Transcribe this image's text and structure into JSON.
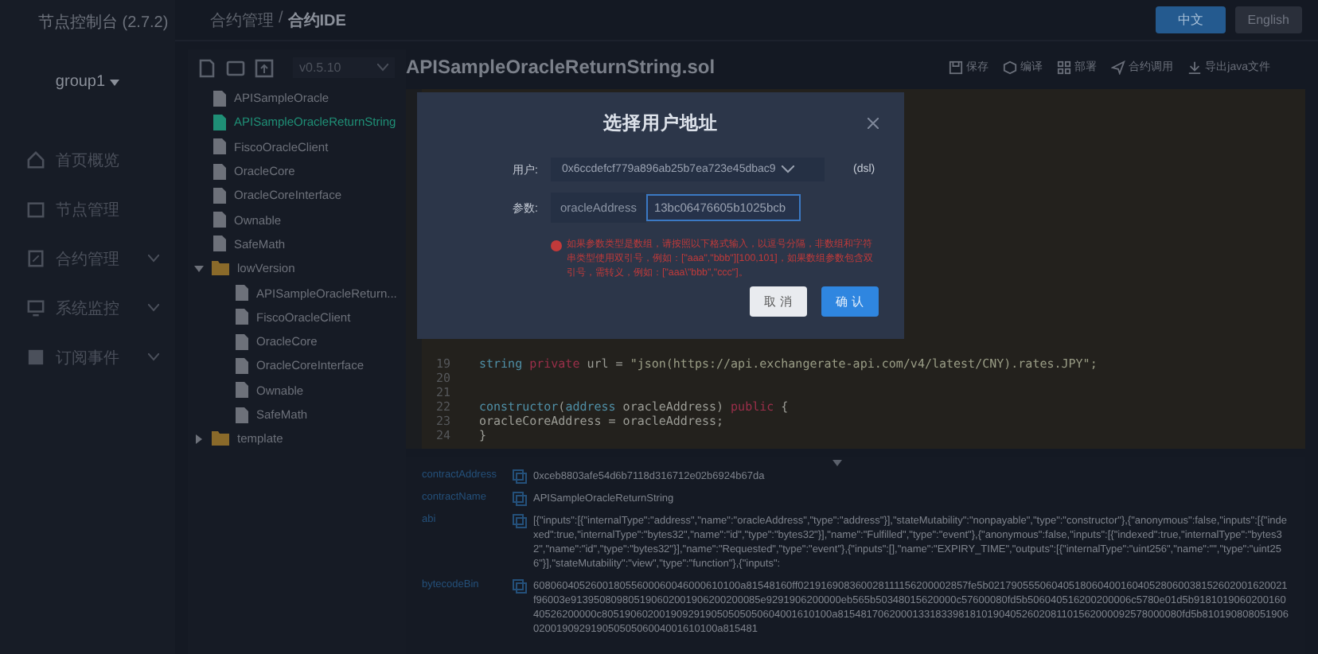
{
  "sidebar": {
    "title": "节点控制台 (2.7.2)",
    "group": "group1",
    "menu": [
      {
        "label": "首页概览",
        "expandable": false
      },
      {
        "label": "节点管理",
        "expandable": false
      },
      {
        "label": "合约管理",
        "expandable": true
      },
      {
        "label": "系统监控",
        "expandable": true
      },
      {
        "label": "订阅事件",
        "expandable": true
      }
    ]
  },
  "topbar": {
    "breadcrumb": [
      "合约管理",
      "合约IDE"
    ],
    "breadcrumb_separator": "/",
    "languages": [
      {
        "label": "中文",
        "selected": true
      },
      {
        "label": "English",
        "selected": false
      }
    ]
  },
  "file_panel": {
    "version": "v0.5.10",
    "tree": [
      {
        "kind": "file",
        "name": "APISampleOracle",
        "selected": false
      },
      {
        "kind": "file",
        "name": "APISampleOracleReturnString",
        "selected": true
      },
      {
        "kind": "file",
        "name": "FiscoOracleClient",
        "selected": false
      },
      {
        "kind": "file",
        "name": "OracleCore",
        "selected": false
      },
      {
        "kind": "file",
        "name": "OracleCoreInterface",
        "selected": false
      },
      {
        "kind": "file",
        "name": "Ownable",
        "selected": false
      },
      {
        "kind": "file",
        "name": "SafeMath",
        "selected": false
      },
      {
        "kind": "folder",
        "name": "lowVersion",
        "expanded": true,
        "children": [
          {
            "kind": "file",
            "name": "APISampleOracleReturn...",
            "selected": false
          },
          {
            "kind": "file",
            "name": "FiscoOracleClient",
            "selected": false
          },
          {
            "kind": "file",
            "name": "OracleCore",
            "selected": false
          },
          {
            "kind": "file",
            "name": "OracleCoreInterface",
            "selected": false
          },
          {
            "kind": "file",
            "name": "Ownable",
            "selected": false
          },
          {
            "kind": "file",
            "name": "SafeMath",
            "selected": false
          }
        ]
      },
      {
        "kind": "folder",
        "name": "template",
        "expanded": false
      }
    ]
  },
  "editor": {
    "filename": "APISampleOracleReturnString.sol",
    "actions": [
      {
        "label": "保存"
      },
      {
        "label": "编译"
      },
      {
        "label": "部署"
      },
      {
        "label": "合约调用"
      },
      {
        "label": "导出java文件"
      }
    ],
    "lines": [
      {
        "number": "19",
        "tokens": [
          {
            "kind": "type",
            "text": "string "
          },
          {
            "kind": "keyword",
            "text": "private"
          },
          {
            "kind": "plain",
            "text": " url = "
          },
          {
            "kind": "string",
            "text": "\"json(https://api.exchangerate-api.com/v4/latest/CNY).rates.JPY\";"
          }
        ]
      },
      {
        "number": "20"
      },
      {
        "number": "21"
      },
      {
        "number": "22",
        "tokens": [
          {
            "kind": "type",
            "text": "constructor"
          },
          {
            "kind": "plain",
            "text": "("
          },
          {
            "kind": "type",
            "text": "address"
          },
          {
            "kind": "plain",
            "text": " oracleAddress) "
          },
          {
            "kind": "keyword",
            "text": "public"
          },
          {
            "kind": "plain",
            "text": " {"
          }
        ]
      },
      {
        "number": "23",
        "tokens": [
          {
            "kind": "plain",
            "text": "    oracleCoreAddress = oracleAddress;"
          }
        ]
      },
      {
        "number": "24",
        "tokens": [
          {
            "kind": "plain",
            "text": "}"
          }
        ]
      }
    ]
  },
  "result": [
    {
      "label": "contractAddress",
      "value": "0xceb8803afe54d6b7118d316712e02b6924b67da"
    },
    {
      "label": "contractName",
      "value": "APISampleOracleReturnString"
    },
    {
      "label": "abi",
      "value": "[{\"inputs\":[{\"internalType\":\"address\",\"name\":\"oracleAddress\",\"type\":\"address\"}],\"stateMutability\":\"nonpayable\",\"type\":\"constructor\"},{\"anonymous\":false,\"inputs\":[{\"indexed\":true,\"internalType\":\"bytes32\",\"name\":\"id\",\"type\":\"bytes32\"}],\"name\":\"Fulfilled\",\"type\":\"event\"},{\"anonymous\":false,\"inputs\":[{\"indexed\":true,\"internalType\":\"bytes32\",\"name\":\"id\",\"type\":\"bytes32\"}],\"name\":\"Requested\",\"type\":\"event\"},{\"inputs\":[],\"name\":\"EXPIRY_TIME\",\"outputs\":[{\"internalType\":\"uint256\",\"name\":\"\",\"type\":\"uint256\"}],\"stateMutability\":\"view\",\"type\":\"function\"},{\"inputs\":"
    },
    {
      "label": "bytecodeBin",
      "value": "608060405260018055600060046000610100a81548160ff021916908360028111156200002857fe5b0217905550604051806040016040528060038152602001620021f96003e913950809805190602001906200200085e9291906200000eb565b50348015620000c57600080fd5b506040516200200006c5780e01d5b918101906020016040526200000c8051906020019092919050505050604001610100a815481706200013318339818101904052602081101562000092578000080fd5b81019080805190602001909291905050506004001610100a815481"
    }
  ],
  "dialog": {
    "title": "选择用户地址",
    "user_label": "用户:",
    "user_value": "0x6ccdefcf779a896ab25b7ea723e45dbac9",
    "user_name": "(dsl)",
    "param_label": "参数:",
    "param_name": "oracleAddress",
    "param_value": "13bc06476605b1025bcb",
    "hint": "如果参数类型是数组，请按照以下格式输入，以逗号分隔，非数组和字符串类型使用双引号，例如：[\"aaa\",\"bbb\"][100,101]，如果数组参数包含双引号，需转义，例如：[\"aaa\\\"bbb\",\"ccc\"]。",
    "buttons": [
      {
        "label": "取 消",
        "kind": "secondary"
      },
      {
        "label": "确 认",
        "kind": "primary"
      }
    ]
  }
}
